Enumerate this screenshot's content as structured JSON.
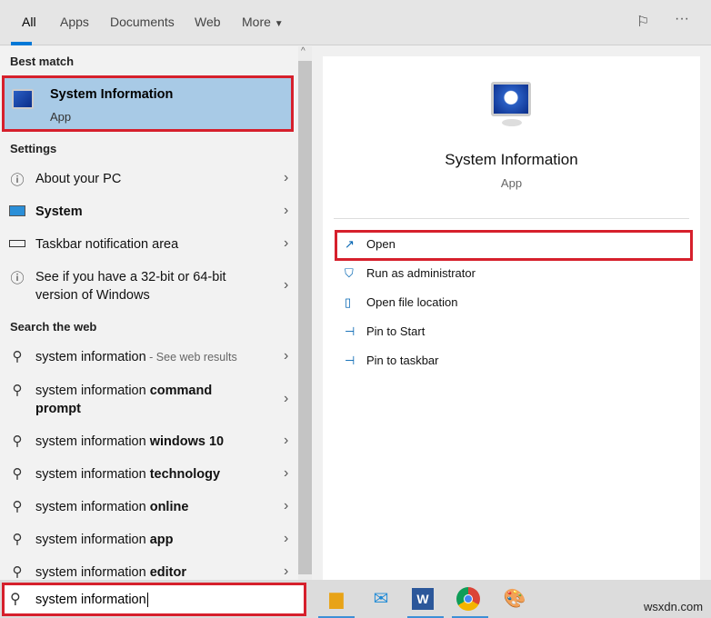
{
  "tabs": [
    {
      "label": "All"
    },
    {
      "label": "Apps"
    },
    {
      "label": "Documents"
    },
    {
      "label": "Web"
    },
    {
      "label": "More"
    }
  ],
  "left": {
    "best_match_heading": "Best match",
    "best_match": {
      "title": "System Information",
      "subtitle": "App"
    },
    "settings_heading": "Settings",
    "settings": [
      {
        "label": "About your PC",
        "icon": "info-icon"
      },
      {
        "label": "System",
        "icon": "monitor-icon"
      },
      {
        "label": "Taskbar notification area",
        "icon": "taskbar-icon"
      },
      {
        "label": "See if you have a 32-bit or 64-bit version of Windows",
        "line1": "See if you have a 32-bit or 64-bit",
        "line2": "version of Windows",
        "icon": "info-icon"
      }
    ],
    "web_heading": "Search the web",
    "web": [
      {
        "plain": "system information",
        "bold": "",
        "extra": " - See web results"
      },
      {
        "plain": "system information ",
        "bold": "command",
        "bold2": "prompt"
      },
      {
        "plain": "system information ",
        "bold": "windows 10"
      },
      {
        "plain": "system information ",
        "bold": "technology"
      },
      {
        "plain": "system information ",
        "bold": "online"
      },
      {
        "plain": "system information ",
        "bold": "app"
      },
      {
        "plain": "system information ",
        "bold": "editor"
      }
    ]
  },
  "right": {
    "title": "System Information",
    "subtitle": "App",
    "actions": [
      {
        "label": "Open"
      },
      {
        "label": "Run as administrator"
      },
      {
        "label": "Open file location"
      },
      {
        "label": "Pin to Start"
      },
      {
        "label": "Pin to taskbar"
      }
    ]
  },
  "search": {
    "value": "system information"
  },
  "watermark": "wsxdn.com",
  "colors": {
    "accent": "#0078d7",
    "highlight": "#a8cae6",
    "annotation": "#d6202c"
  }
}
